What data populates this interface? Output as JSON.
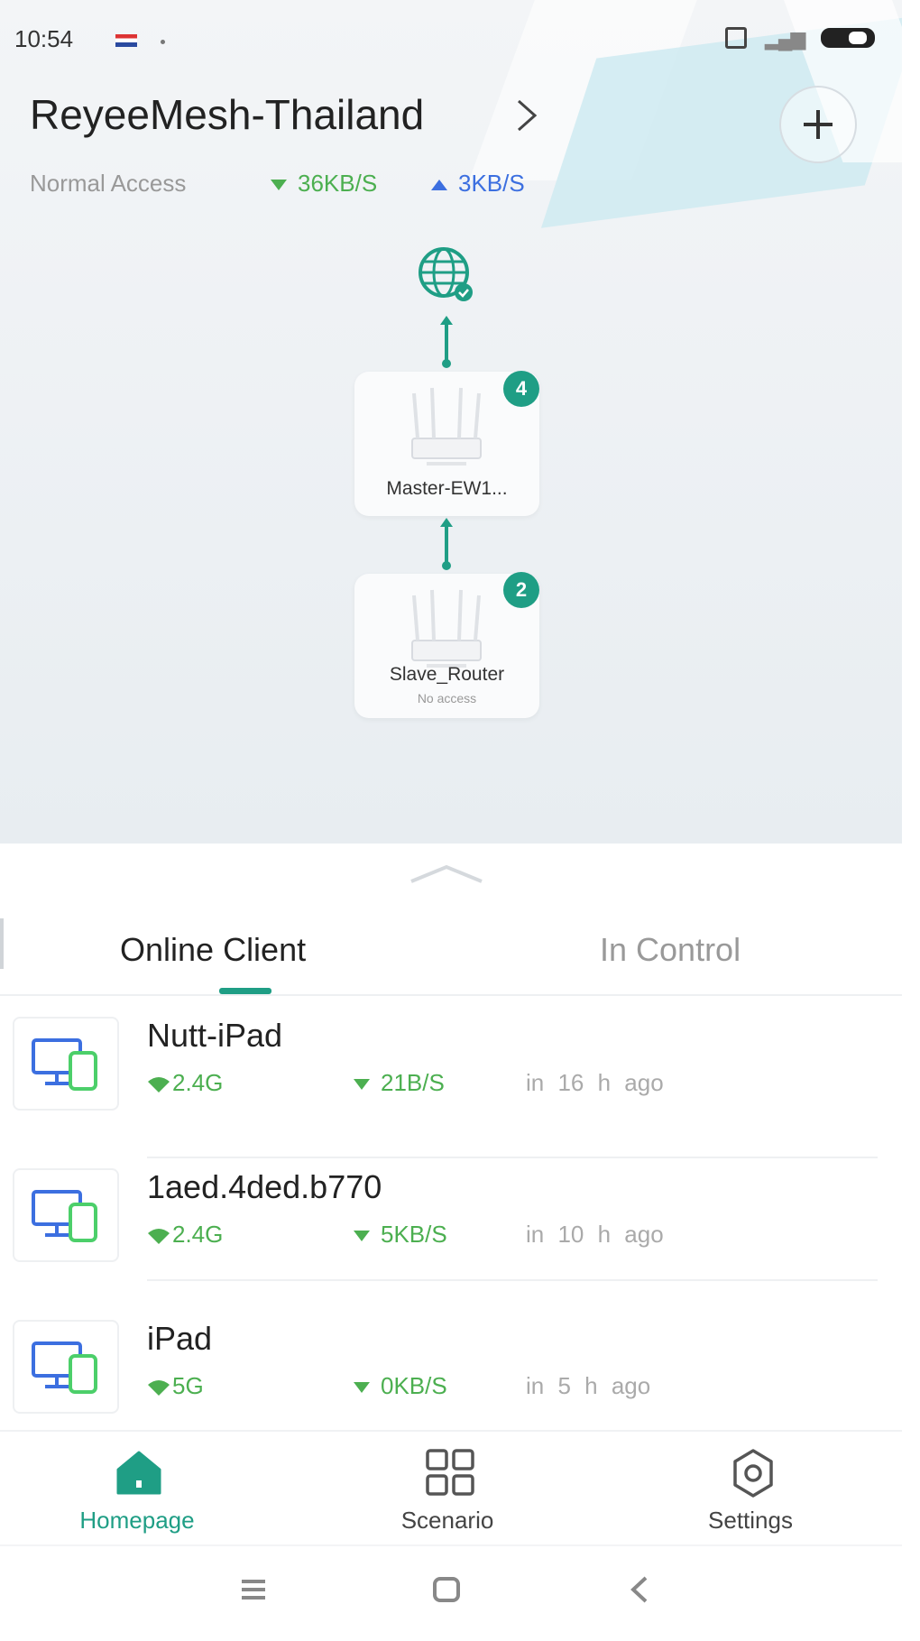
{
  "status_bar": {
    "time": "10:54",
    "icons": [
      "flag-icon",
      "dot-icon",
      "sim-icon",
      "signal-icon",
      "battery-icon"
    ]
  },
  "header": {
    "network_name": "ReyeeMesh-Thailand",
    "access_status": "Normal Access",
    "download_rate": "36KB/S",
    "upload_rate": "3KB/S"
  },
  "topology": {
    "devices": [
      {
        "name": "Master-EW1...",
        "subtitle": "",
        "client_count": "4"
      },
      {
        "name": "Slave_Router",
        "subtitle": "No access",
        "client_count": "2"
      }
    ]
  },
  "tabs": [
    {
      "label": "Online Client",
      "active": true
    },
    {
      "label": "In Control",
      "active": false
    }
  ],
  "clients": [
    {
      "name": "Nutt-iPad",
      "band": "2.4G",
      "rate": "21B/S",
      "time": "in 16 h ago"
    },
    {
      "name": "1aed.4ded.b770",
      "band": "2.4G",
      "rate": "5KB/S",
      "time": "in 10 h ago"
    },
    {
      "name": "iPad",
      "band": "5G",
      "rate": "0KB/S",
      "time": "in 5 h ago"
    }
  ],
  "bottom_nav": [
    {
      "label": "Homepage",
      "icon": "home-icon",
      "active": true
    },
    {
      "label": "Scenario",
      "icon": "grid-icon",
      "active": false
    },
    {
      "label": "Settings",
      "icon": "gear-icon",
      "active": false
    }
  ],
  "colors": {
    "accent": "#1f9e85",
    "download": "#4caf50",
    "upload": "#3c6fe0",
    "device_icon_blue": "#3c6fe0",
    "device_icon_green": "#4ccf6a"
  }
}
